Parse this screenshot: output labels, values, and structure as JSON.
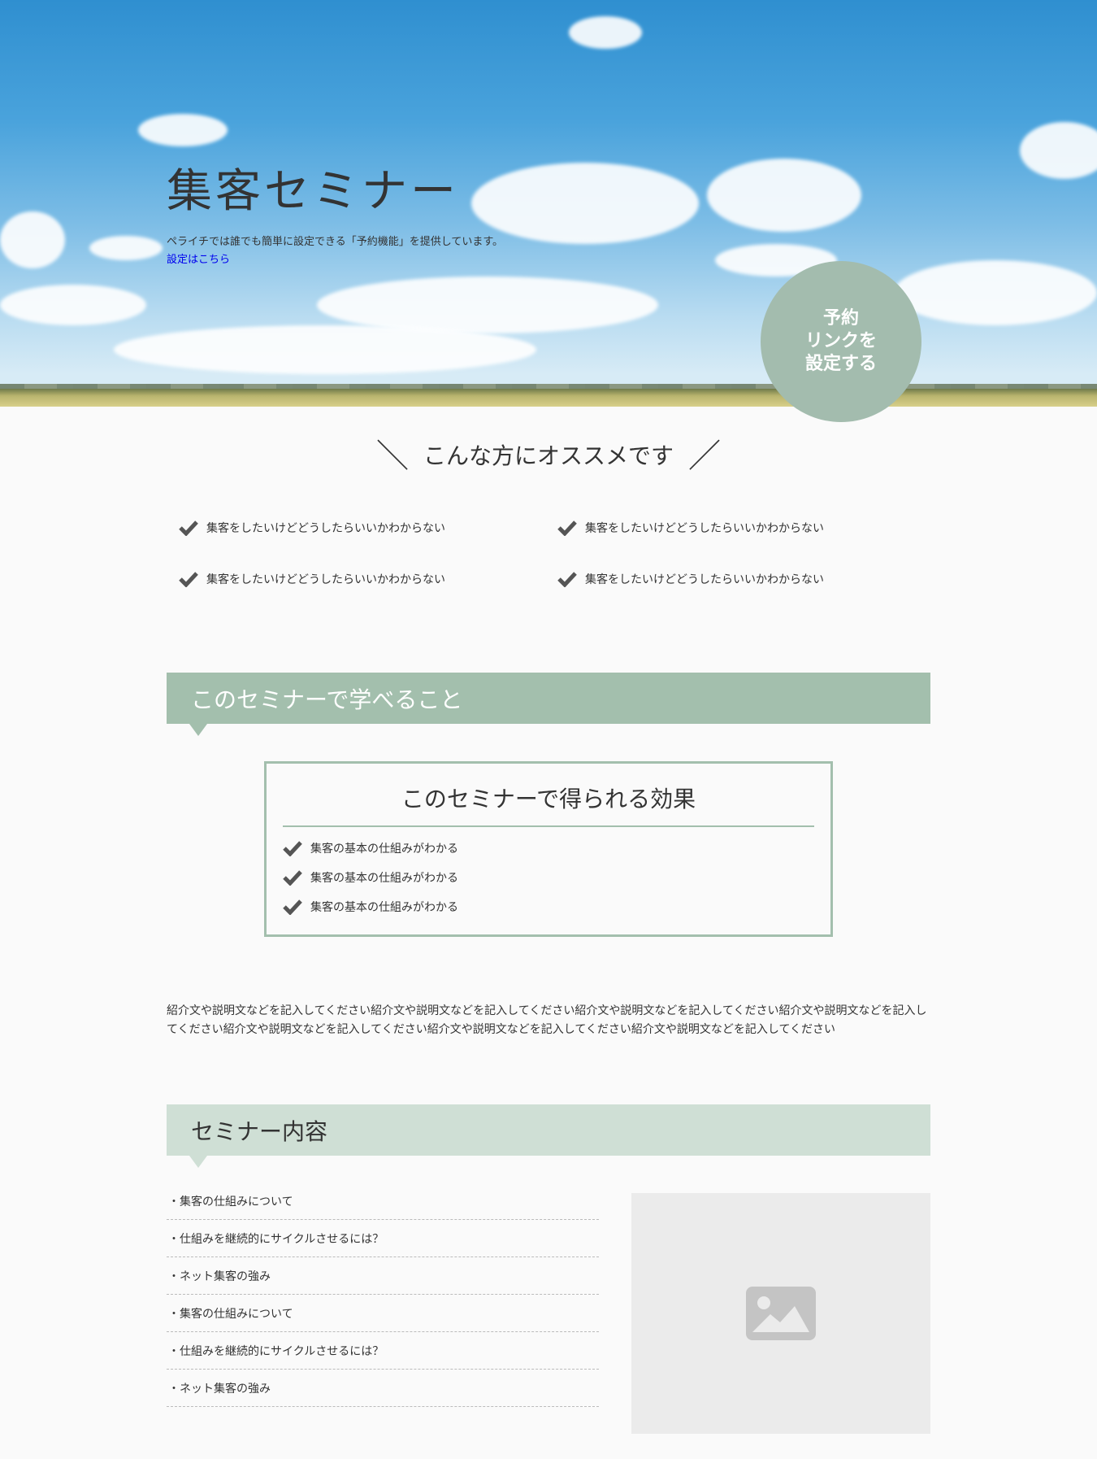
{
  "hero": {
    "title": "集客セミナー",
    "description": "ペライチでは誰でも簡単に設定できる「予約機能」を提供しています。",
    "link_text": "設定はこちら",
    "reserve_button": "予約\nリンクを\n設定する"
  },
  "recommend": {
    "heading": "こんな方にオススメです",
    "items": [
      "集客をしたいけどどうしたらいいかわからない",
      "集客をしたいけどどうしたらいいかわからない",
      "集客をしたいけどどうしたらいいかわからない",
      "集客をしたいけどどうしたらいいかわからない"
    ]
  },
  "learn": {
    "heading": "このセミナーで学べること",
    "effect_title": "このセミナーで得られる効果",
    "effects": [
      "集客の基本の仕組みがわかる",
      "集客の基本の仕組みがわかる",
      "集客の基本の仕組みがわかる"
    ],
    "intro": "紹介文や説明文などを記入してください紹介文や説明文などを記入してください紹介文や説明文などを記入してください紹介文や説明文などを記入してください紹介文や説明文などを記入してください紹介文や説明文などを記入してください紹介文や説明文などを記入してください"
  },
  "content": {
    "heading": "セミナー内容",
    "topics": [
      "・集客の仕組みについて",
      "・仕組みを継続的にサイクルさせるには？",
      "・ネット集客の強み",
      "・集客の仕組みについて",
      "・仕組みを継続的にサイクルさせるには？",
      "・ネット集客の強み"
    ],
    "image_icon": "image-placeholder-icon"
  },
  "colors": {
    "accent": "#a3bfad",
    "accent_light": "#cfdfd5",
    "link": "#0000ee",
    "check": "#555555"
  }
}
